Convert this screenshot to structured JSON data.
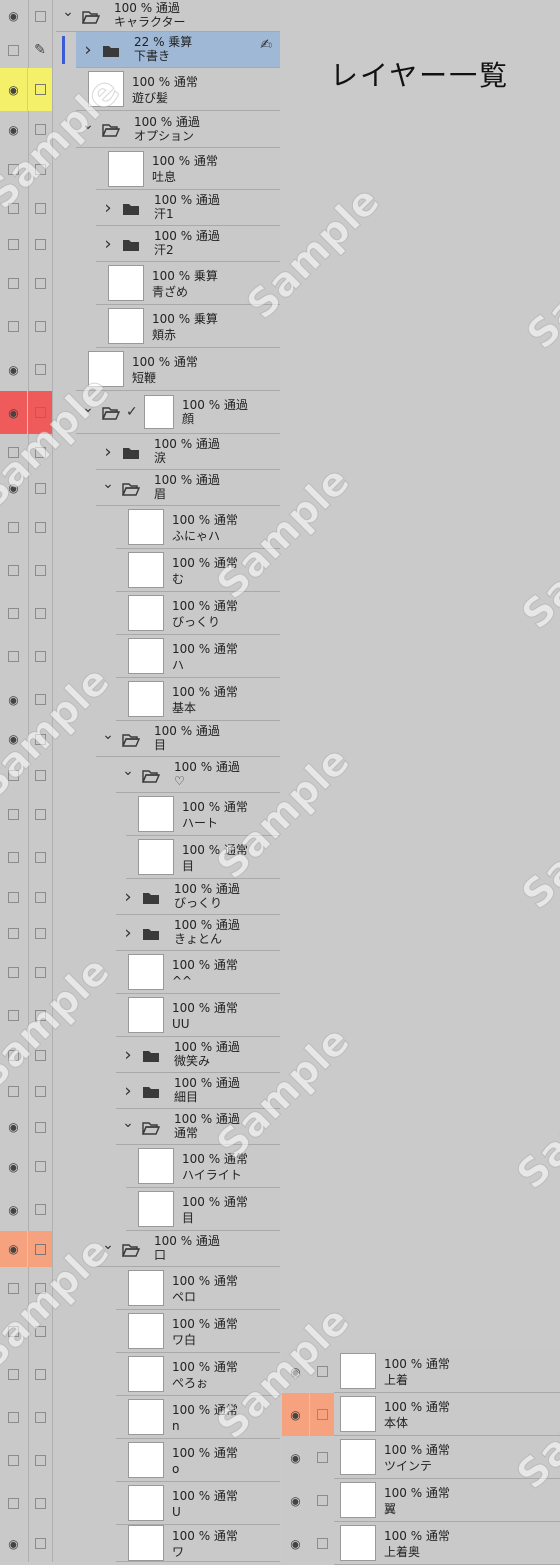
{
  "title": "レイヤー一覧",
  "watermark": "Sample",
  "colors": {
    "selected": "#9fb8d6",
    "yellow": "#f4f06a",
    "red": "#ef5a5a",
    "orange": "#f6a27e"
  },
  "layers": [
    {
      "l1": "100 % 通過",
      "l2": "キャラクター",
      "type": "folder",
      "open": true,
      "eye": true,
      "indent": 0
    },
    {
      "l1": "22 % 乗算",
      "l2": "下書き",
      "type": "folder",
      "open": false,
      "eye": false,
      "indent": 1,
      "selected": true,
      "pen": true
    },
    {
      "l1": "100 % 通常",
      "l2": "遊び髪",
      "type": "layer",
      "eye": true,
      "indent": 1,
      "mark": "yellow"
    },
    {
      "l1": "100 % 通過",
      "l2": "オプション",
      "type": "folder",
      "open": true,
      "eye": true,
      "indent": 1
    },
    {
      "l1": "100 % 通常",
      "l2": "吐息",
      "type": "layer",
      "eye": false,
      "indent": 2
    },
    {
      "l1": "100 % 通過",
      "l2": "汗1",
      "type": "folder",
      "open": false,
      "eye": false,
      "indent": 2
    },
    {
      "l1": "100 % 通過",
      "l2": "汗2",
      "type": "folder",
      "open": false,
      "eye": false,
      "indent": 2
    },
    {
      "l1": "100 % 乗算",
      "l2": "青ざめ",
      "type": "layer",
      "eye": false,
      "indent": 2
    },
    {
      "l1": "100 % 乗算",
      "l2": "頬赤",
      "type": "layer",
      "eye": false,
      "indent": 2
    },
    {
      "l1": "100 % 通常",
      "l2": "短鞭",
      "type": "layer",
      "eye": true,
      "indent": 1
    },
    {
      "l1": "100 % 通過",
      "l2": "顔",
      "type": "folder",
      "open": true,
      "eye": true,
      "indent": 1,
      "mark": "red"
    },
    {
      "l1": "100 % 通過",
      "l2": "涙",
      "type": "folder",
      "open": false,
      "eye": false,
      "indent": 2
    },
    {
      "l1": "100 % 通過",
      "l2": "眉",
      "type": "folder",
      "open": true,
      "eye": true,
      "indent": 2
    },
    {
      "l1": "100 % 通常",
      "l2": "ふにゃハ",
      "type": "layer",
      "eye": false,
      "indent": 3
    },
    {
      "l1": "100 % 通常",
      "l2": "む",
      "type": "layer",
      "eye": false,
      "indent": 3
    },
    {
      "l1": "100 % 通常",
      "l2": "びっくり",
      "type": "layer",
      "eye": false,
      "indent": 3
    },
    {
      "l1": "100 % 通常",
      "l2": "ハ",
      "type": "layer",
      "eye": false,
      "indent": 3
    },
    {
      "l1": "100 % 通常",
      "l2": "基本",
      "type": "layer",
      "eye": true,
      "indent": 3
    },
    {
      "l1": "100 % 通過",
      "l2": "目",
      "type": "folder",
      "open": true,
      "eye": true,
      "indent": 2
    },
    {
      "l1": "100 % 通過",
      "l2": "♡",
      "type": "folder",
      "open": true,
      "eye": false,
      "indent": 3
    },
    {
      "l1": "100 % 通常",
      "l2": "ハート",
      "type": "layer",
      "eye": false,
      "indent": 4
    },
    {
      "l1": "100 % 通常",
      "l2": "目",
      "type": "layer",
      "eye": false,
      "indent": 4
    },
    {
      "l1": "100 % 通過",
      "l2": "びっくり",
      "type": "folder",
      "open": false,
      "eye": false,
      "indent": 3
    },
    {
      "l1": "100 % 通過",
      "l2": "きょとん",
      "type": "folder",
      "open": false,
      "eye": false,
      "indent": 3
    },
    {
      "l1": "100 % 通常",
      "l2": "^^",
      "type": "layer",
      "eye": false,
      "indent": 3
    },
    {
      "l1": "100 % 通常",
      "l2": "UU",
      "type": "layer",
      "eye": false,
      "indent": 3
    },
    {
      "l1": "100 % 通過",
      "l2": "微笑み",
      "type": "folder",
      "open": false,
      "eye": false,
      "indent": 3
    },
    {
      "l1": "100 % 通過",
      "l2": "細目",
      "type": "folder",
      "open": false,
      "eye": false,
      "indent": 3
    },
    {
      "l1": "100 % 通過",
      "l2": "通常",
      "type": "folder",
      "open": true,
      "eye": true,
      "indent": 3
    },
    {
      "l1": "100 % 通常",
      "l2": "ハイライト",
      "type": "layer",
      "eye": true,
      "indent": 4
    },
    {
      "l1": "100 % 通常",
      "l2": "目",
      "type": "layer",
      "eye": true,
      "indent": 4
    },
    {
      "l1": "100 % 通過",
      "l2": "口",
      "type": "folder",
      "open": true,
      "eye": true,
      "indent": 2,
      "mark": "orange"
    },
    {
      "l1": "100 % 通常",
      "l2": "ペロ",
      "type": "layer",
      "eye": false,
      "indent": 3
    },
    {
      "l1": "100 % 通常",
      "l2": "ワ白",
      "type": "layer",
      "eye": false,
      "indent": 3
    },
    {
      "l1": "100 % 通常",
      "l2": "ぺろぉ",
      "type": "layer",
      "eye": false,
      "indent": 3
    },
    {
      "l1": "100 % 通常",
      "l2": "n",
      "type": "layer",
      "eye": false,
      "indent": 3
    },
    {
      "l1": "100 % 通常",
      "l2": "o",
      "type": "layer",
      "eye": false,
      "indent": 3
    },
    {
      "l1": "100 % 通常",
      "l2": "U",
      "type": "layer",
      "eye": false,
      "indent": 3
    },
    {
      "l1": "100 % 通常",
      "l2": "ワ",
      "type": "layer",
      "eye": true,
      "indent": 3
    }
  ],
  "layers2": [
    {
      "l1": "100 % 通常",
      "l2": "上着",
      "eye": true
    },
    {
      "l1": "100 % 通常",
      "l2": "本体",
      "eye": true,
      "mark": "orange"
    },
    {
      "l1": "100 % 通常",
      "l2": "ツインテ",
      "eye": true
    },
    {
      "l1": "100 % 通常",
      "l2": "翼",
      "eye": true
    },
    {
      "l1": "100 % 通常",
      "l2": "上着奥",
      "eye": true
    }
  ]
}
